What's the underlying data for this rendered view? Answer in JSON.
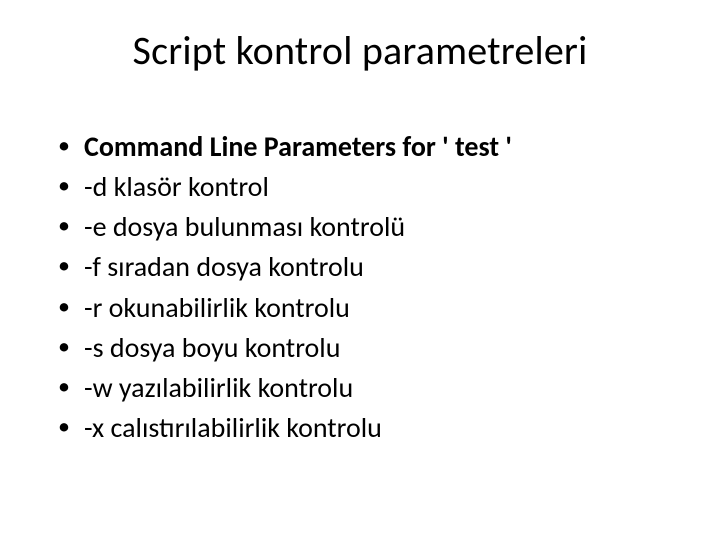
{
  "title": "Script kontrol parametreleri",
  "items": [
    {
      "text": "Command Line Parameters for ' test '",
      "bold": true
    },
    {
      "text": "-d klasör kontrol",
      "bold": false
    },
    {
      "text": "-e dosya bulunması kontrolü",
      "bold": false
    },
    {
      "text": "-f sıradan dosya kontrolu",
      "bold": false
    },
    {
      "text": "-r okunabilirlik kontrolu",
      "bold": false
    },
    {
      "text": "-s dosya boyu kontrolu",
      "bold": false
    },
    {
      "text": "-w yazılabilirlik kontrolu",
      "bold": false
    },
    {
      "text": "-x calıstırılabilirlik kontrolu",
      "bold": false
    }
  ]
}
